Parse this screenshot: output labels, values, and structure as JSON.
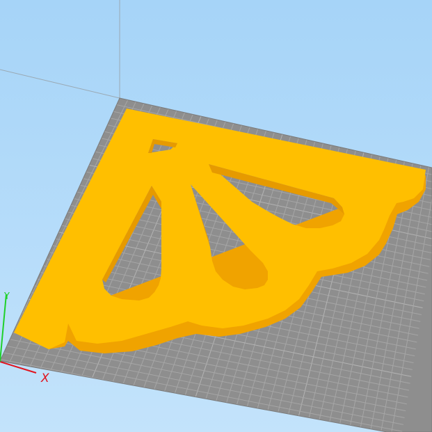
{
  "viewport": {
    "kind": "3d-slicer-viewport",
    "background_top_color": "#a6d4f8",
    "background_bottom_color": "#c3e3fb",
    "build_plate_color": "#8e8e8e",
    "grid_line_color": "#a6a6a6",
    "model_top_color": "#ffbf00",
    "model_side_color": "#f0a300"
  },
  "axes": {
    "x_label": "X",
    "y_label": "Y",
    "x_color": "#e0141e",
    "y_color": "#1fd02a"
  }
}
